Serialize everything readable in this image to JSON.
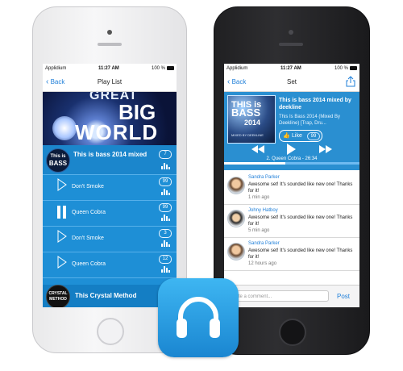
{
  "colors": {
    "accent": "#1f7fd9",
    "list_bg": "#1e8fd6",
    "app_icon": "#2a9fe3"
  },
  "left_phone": {
    "status": {
      "carrier": "Applidium",
      "time": "11:27 AM",
      "battery": "100 %"
    },
    "nav": {
      "back_label": "Back",
      "title": "Play List"
    },
    "hero": {
      "line1": "GREAT",
      "line2": "BIG",
      "line3": "WORLD"
    },
    "featured": {
      "art_line1": "This is",
      "art_line2": "BASS",
      "title": "This is bass 2014 mixed",
      "badge": "7"
    },
    "tracks": [
      {
        "name": "Don't Smoke",
        "badge": "99",
        "state": "paused"
      },
      {
        "name": "Queen Cobra",
        "badge": "99",
        "state": "playing"
      },
      {
        "name": "Don't Smoke",
        "badge": "3",
        "state": "paused"
      },
      {
        "name": "Queen Cobra",
        "badge": "12",
        "state": "paused"
      }
    ],
    "bottom": {
      "art_line1": "CRYSTAL",
      "art_line2": "METHOD",
      "title": "This Crystal Method"
    }
  },
  "right_phone": {
    "status": {
      "carrier": "Applidium",
      "time": "11:27 AM",
      "battery": "100 %"
    },
    "nav": {
      "back_label": "Back",
      "title": "Set"
    },
    "set": {
      "cover_line1": "THIS is",
      "cover_line2": "BASS",
      "cover_line3": "2014",
      "cover_caption": "MIXED BY DEEKLINE",
      "title": "This is bass 2014 mixed by deekline",
      "subtitle": "This Is Bass 2014 (Mixed By Deekline) [Trap, Dru...",
      "like_label": "Like",
      "like_count": "99",
      "now_playing": "2. Queen Cobra - 26:34",
      "progress": 0.45
    },
    "comments": [
      {
        "name": "Sandra Parker",
        "text": "Awesome set! It's sounded like new one! Thanks for it!",
        "time": "1 min ago"
      },
      {
        "name": "Johny Hatboy",
        "text": "Awesome set! It's sounded like new one! Thanks for it!",
        "time": "5 min ago"
      },
      {
        "name": "Sandra Parker",
        "text": "Awesome set! It's sounded like new one! Thanks for it!",
        "time": "12 hours ago"
      }
    ],
    "composer": {
      "placeholder": "Write a comment...",
      "post_label": "Post"
    }
  },
  "app_icon": {
    "icon": "headphones-icon"
  }
}
